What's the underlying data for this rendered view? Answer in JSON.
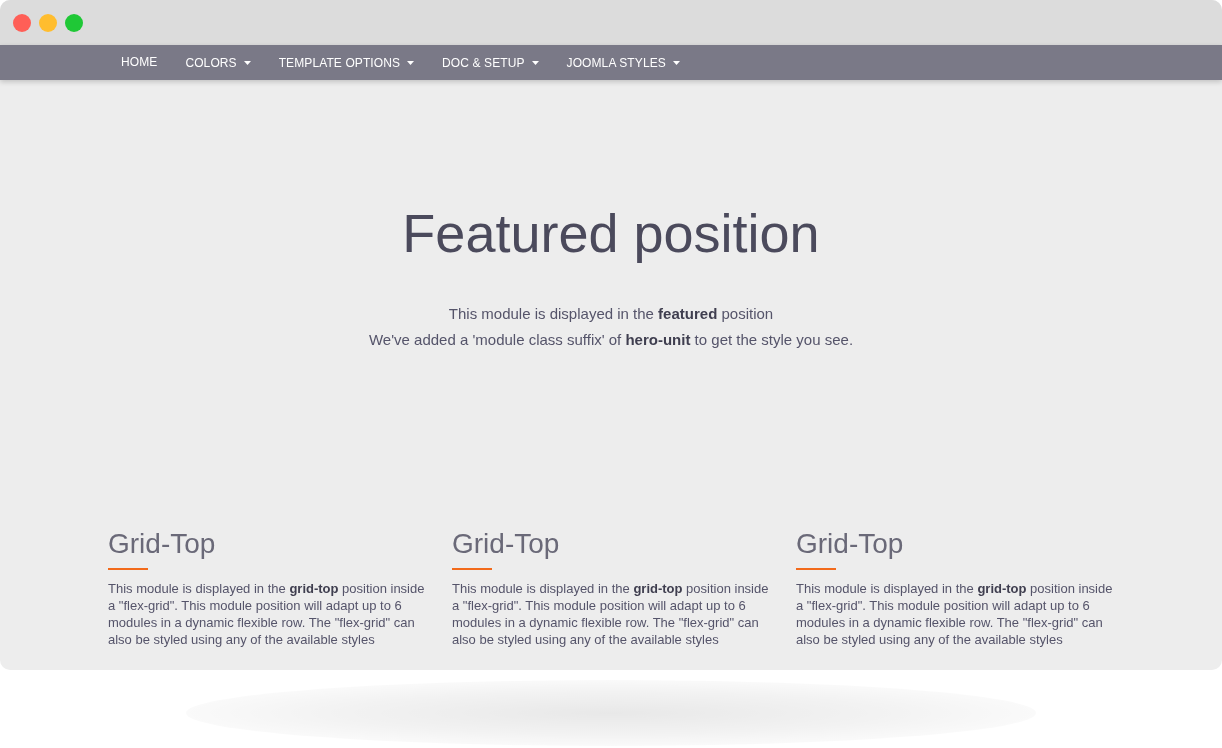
{
  "window_controls": [
    {
      "color": "#ff5f57"
    },
    {
      "color": "#ffbd2e"
    },
    {
      "color": "#1fc836"
    }
  ],
  "nav": {
    "items": [
      {
        "label": "HOME",
        "dropdown": false
      },
      {
        "label": "COLORS",
        "dropdown": true
      },
      {
        "label": "TEMPLATE OPTIONS",
        "dropdown": true
      },
      {
        "label": "DOC & SETUP",
        "dropdown": true
      },
      {
        "label": "JOOMLA STYLES",
        "dropdown": true
      }
    ]
  },
  "hero": {
    "title": "Featured position",
    "lines": [
      "This module is displayed in the **featured** position",
      "We've added a 'module class suffix' of **hero-unit** to get the style you see."
    ]
  },
  "grid": {
    "modules": [
      {
        "title": "Grid-Top",
        "text": "This module is displayed in the **grid-top** position inside a \"flex-grid\". This module position will adapt up to 6 modules in a dynamic flexible row. The \"flex-grid\" can also be styled using any of the available styles"
      },
      {
        "title": "Grid-Top",
        "text": "This module is displayed in the **grid-top** position inside a \"flex-grid\". This module position will adapt up to 6 modules in a dynamic flexible row. The \"flex-grid\" can also be styled using any of the available styles"
      },
      {
        "title": "Grid-Top",
        "text": "This module is displayed in the **grid-top** position inside a \"flex-grid\". This module position will adapt up to 6 modules in a dynamic flexible row. The \"flex-grid\" can also be styled using any of the available styles"
      }
    ]
  }
}
